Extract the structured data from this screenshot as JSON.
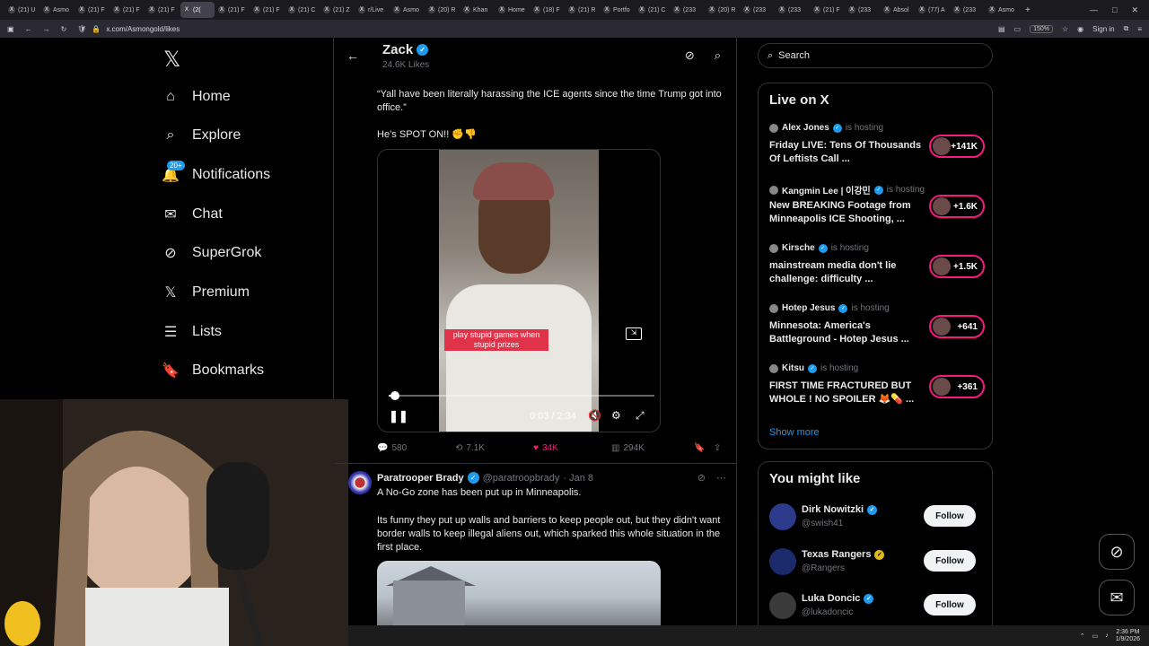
{
  "browser": {
    "tabs": [
      {
        "label": "(21) U"
      },
      {
        "label": "Asmo"
      },
      {
        "label": "(21) F"
      },
      {
        "label": "(21) F"
      },
      {
        "label": "(21) F"
      },
      {
        "label": "(2(",
        "active": true
      },
      {
        "label": "(21) F"
      },
      {
        "label": "(21) F"
      },
      {
        "label": "(21) C"
      },
      {
        "label": "(21) Z"
      },
      {
        "label": "r/Live"
      },
      {
        "label": "Asmo"
      },
      {
        "label": "(20) R"
      },
      {
        "label": "Khan"
      },
      {
        "label": "Home"
      },
      {
        "label": "(18) F"
      },
      {
        "label": "(21) R"
      },
      {
        "label": "Portfo"
      },
      {
        "label": "(21) C"
      },
      {
        "label": "(233"
      },
      {
        "label": "(20) R"
      },
      {
        "label": "(233"
      },
      {
        "label": "(233"
      },
      {
        "label": "(21) F"
      },
      {
        "label": "(233"
      },
      {
        "label": "Absol"
      },
      {
        "label": "(77) A"
      },
      {
        "label": "(233"
      },
      {
        "label": "Asmo"
      }
    ],
    "url": "x.com/Asmongold/likes",
    "zoom": "150%",
    "signin": "Sign in"
  },
  "sidebar": {
    "items": [
      {
        "label": "Home"
      },
      {
        "label": "Explore"
      },
      {
        "label": "Notifications",
        "badge": "20+"
      },
      {
        "label": "Chat"
      },
      {
        "label": "SuperGrok"
      },
      {
        "label": "Premium"
      },
      {
        "label": "Lists"
      },
      {
        "label": "Bookmarks"
      }
    ]
  },
  "profile": {
    "name": "Zack",
    "likes": "24.6K Likes"
  },
  "tweet1": {
    "text": "“Yall have been literally harassing the ICE agents since the time Trump got into office.”",
    "text2": "He’s SPOT ON!! ✊👎",
    "video": {
      "caption": "play stupid games when stupid prizes",
      "time": "0:03 / 2:34",
      "progress": 0.02
    },
    "stats": {
      "replies": "580",
      "reposts": "7.1K",
      "likes": "34K",
      "views": "294K"
    }
  },
  "tweet2": {
    "author": "Paratrooper Brady",
    "handle": "@paratroopbrady",
    "date": "· Jan 8",
    "line1": "A No-Go zone has been put up in Minneapolis.",
    "body": "Its funny they put up walls and barriers to keep people out, but they didn't want border walls to keep illegal aliens out, which sparked this whole situation in the first place."
  },
  "right": {
    "search_placeholder": "Search",
    "live_title": "Live on X",
    "live": [
      {
        "host": "Alex Jones",
        "status": "is hosting",
        "title": "Friday LIVE: Tens Of Thousands Of Leftists Call ...",
        "count": "+141K"
      },
      {
        "host": "Kangmin Lee | 이강민",
        "status": "is hosting",
        "title": "New BREAKING Footage from Minneapolis ICE Shooting, ...",
        "count": "+1.6K"
      },
      {
        "host": "Kirsche",
        "status": "is hosting",
        "title": "mainstream media don't lie challenge: difficulty ...",
        "count": "+1.5K"
      },
      {
        "host": "Hotep Jesus",
        "status": "is hosting",
        "title": "Minnesota: America's Battleground - Hotep Jesus ...",
        "count": "+641"
      },
      {
        "host": "Kitsu",
        "status": "is hosting",
        "title": "FIRST TIME FRACTURED BUT WHOLE ! NO SPOILER 🦊💊 ...",
        "count": "+361"
      }
    ],
    "show_more": "Show more",
    "wtf_title": "You might like",
    "follow": [
      {
        "name": "Dirk Nowitzki",
        "handle": "@swish41",
        "button": "Follow"
      },
      {
        "name": "Texas Rangers",
        "handle": "@Rangers",
        "button": "Follow"
      },
      {
        "name": "Luka Doncic",
        "handle": "@lukadoncic",
        "button": "Follow"
      }
    ]
  },
  "taskbar": {
    "time": "2:36 PM",
    "date": "1/9/2026"
  }
}
